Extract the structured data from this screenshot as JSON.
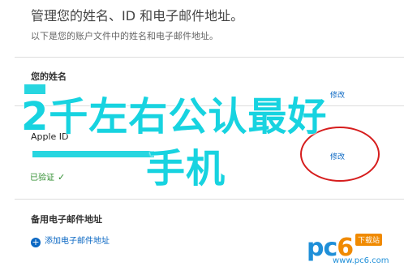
{
  "header": {
    "title": "管理您的姓名、ID 和电子邮件地址。",
    "subtitle": "以下是您的账户文件中的姓名和电子邮件地址。"
  },
  "name_section": {
    "label": "您的姓名",
    "edit_label": "修改"
  },
  "appleid_section": {
    "label": "Apple ID",
    "edit_label": "修改",
    "status": "已验证",
    "status_mark": "✓"
  },
  "backup_email": {
    "label": "备用电子邮件地址",
    "add_label": "添加电子邮件地址",
    "add_icon": "plus-circle-icon"
  },
  "overlay": {
    "line1": "2千左右公认最好",
    "line2": "手机"
  },
  "watermark": {
    "brand_pc": "pc",
    "brand_six": "6",
    "badge": "下载站",
    "url": "www.pc6.com"
  },
  "colors": {
    "overlay": "#17d3e0",
    "link": "#0a67c3",
    "verified": "#2d8c2d",
    "circle": "#d61d1d"
  }
}
